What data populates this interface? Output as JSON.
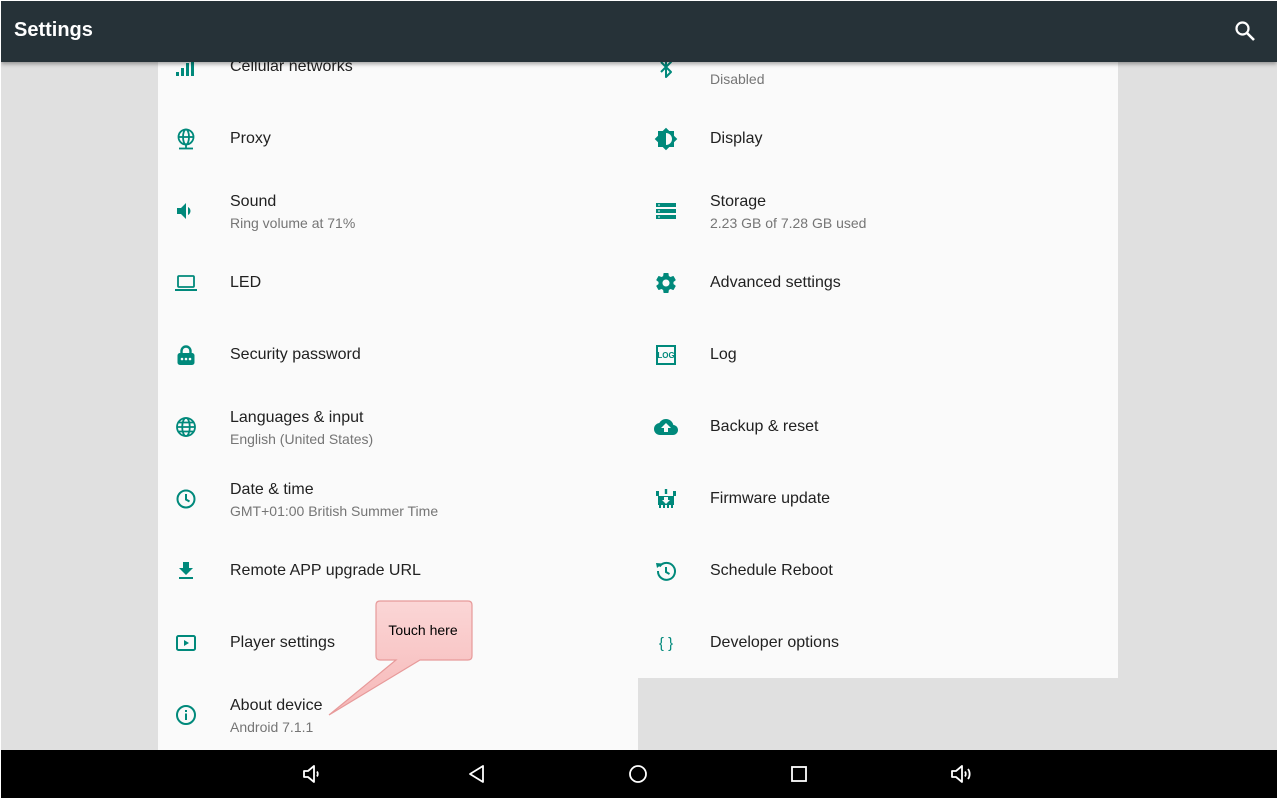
{
  "app_bar": {
    "title": "Settings",
    "search_icon": "search-icon"
  },
  "colors": {
    "app_bar": "#263238",
    "accent": "#00897b",
    "background": "#e0e0e0",
    "panel": "#fafafa",
    "callout": "#f8c4c4"
  },
  "left_items": [
    {
      "title": "Cellular networks",
      "subtitle": "",
      "icon": "signal-bars-icon"
    },
    {
      "title": "Proxy",
      "subtitle": "",
      "icon": "globe-network-icon"
    },
    {
      "title": "Sound",
      "subtitle": "Ring volume at 71%",
      "icon": "volume-icon"
    },
    {
      "title": "LED",
      "subtitle": "",
      "icon": "laptop-icon"
    },
    {
      "title": "Security password",
      "subtitle": "",
      "icon": "lock-icon"
    },
    {
      "title": "Languages & input",
      "subtitle": "English (United States)",
      "icon": "globe-icon"
    },
    {
      "title": "Date & time",
      "subtitle": "GMT+01:00 British Summer Time",
      "icon": "clock-icon"
    },
    {
      "title": "Remote APP upgrade URL",
      "subtitle": "",
      "icon": "download-icon"
    },
    {
      "title": "Player settings",
      "subtitle": "",
      "icon": "play-icon"
    },
    {
      "title": "About device",
      "subtitle": "Android 7.1.1",
      "icon": "info-icon"
    }
  ],
  "right_items": [
    {
      "title": "",
      "subtitle": "Disabled",
      "icon": "bluetooth-icon"
    },
    {
      "title": "Display",
      "subtitle": "",
      "icon": "brightness-icon"
    },
    {
      "title": "Storage",
      "subtitle": "2.23 GB of 7.28 GB used",
      "icon": "storage-icon"
    },
    {
      "title": "Advanced settings",
      "subtitle": "",
      "icon": "gear-icon"
    },
    {
      "title": "Log",
      "subtitle": "",
      "icon": "log-icon",
      "icon_text": "LOG"
    },
    {
      "title": "Backup & reset",
      "subtitle": "",
      "icon": "cloud-upload-icon"
    },
    {
      "title": "Firmware update",
      "subtitle": "",
      "icon": "firmware-icon"
    },
    {
      "title": "Schedule Reboot",
      "subtitle": "",
      "icon": "restore-icon"
    },
    {
      "title": "Developer options",
      "subtitle": "",
      "icon": "braces-icon",
      "icon_text": "{ }"
    }
  ],
  "callout": {
    "text": "Touch here"
  },
  "nav_bar": [
    "volume-down-icon",
    "back-icon",
    "home-icon",
    "recents-icon",
    "volume-up-icon"
  ]
}
